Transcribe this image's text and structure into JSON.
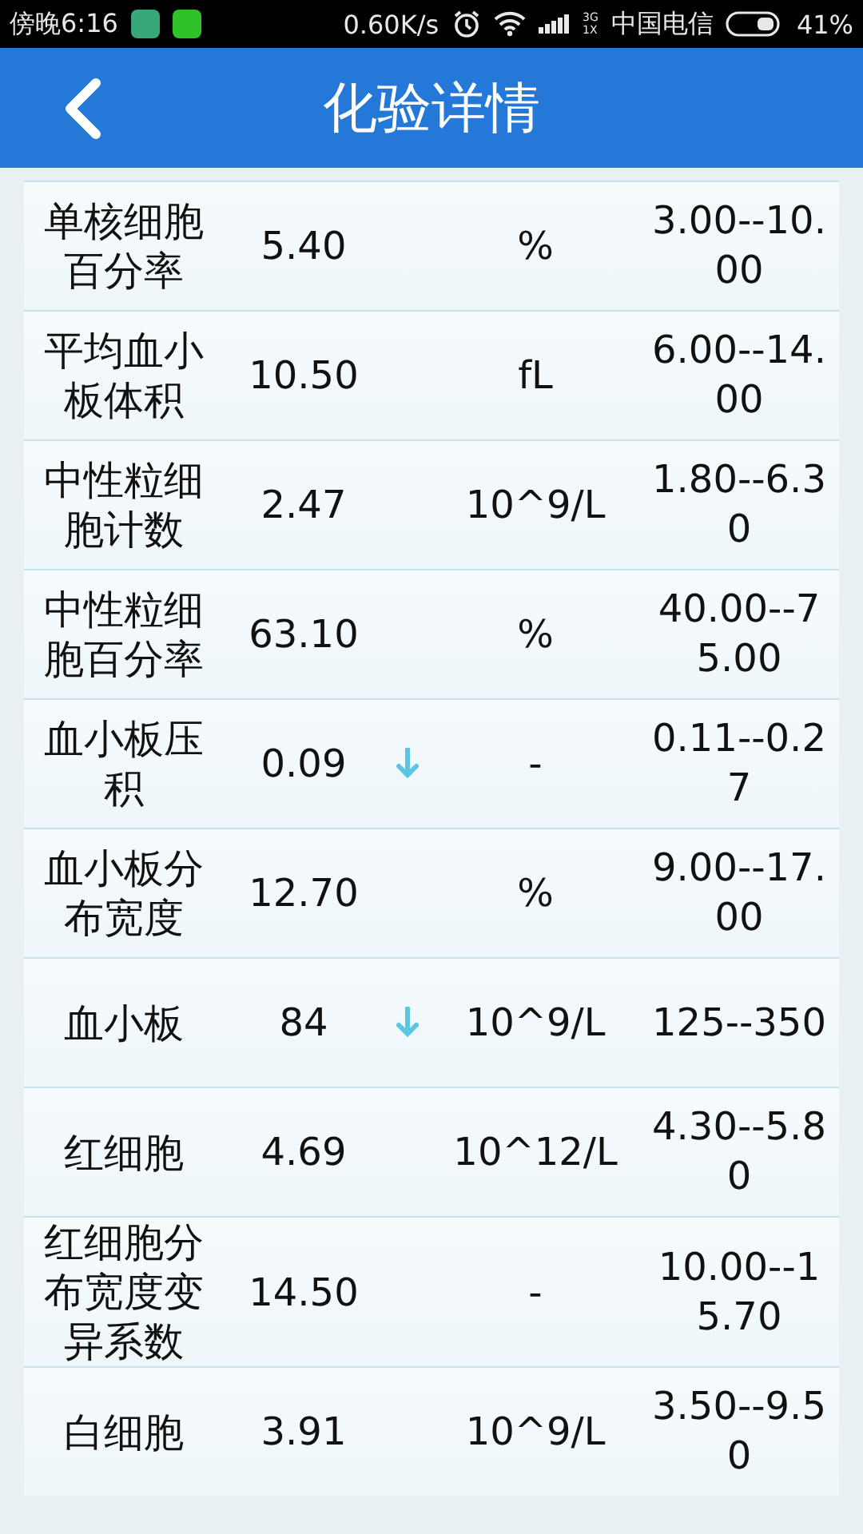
{
  "status_bar": {
    "time": "傍晚6:16",
    "speed": "0.60K/s",
    "network_type_top": "3G",
    "network_type_bottom": "1X",
    "carrier": "中国电信",
    "battery": "41%"
  },
  "header": {
    "title": "化验详情"
  },
  "results": [
    {
      "name": "单核细胞百分率",
      "value": "5.40",
      "low": false,
      "unit": "%",
      "range": "3.00--10.00"
    },
    {
      "name": "平均血小板体积",
      "value": "10.50",
      "low": false,
      "unit": "fL",
      "range": "6.00--14.00"
    },
    {
      "name": "中性粒细胞计数",
      "value": "2.47",
      "low": false,
      "unit": "10^9/L",
      "range": "1.80--6.30"
    },
    {
      "name": "中性粒细胞百分率",
      "value": "63.10",
      "low": false,
      "unit": "%",
      "range": "40.00--75.00"
    },
    {
      "name": "血小板压积",
      "value": "0.09",
      "low": true,
      "unit": "-",
      "range": "0.11--0.27"
    },
    {
      "name": "血小板分布宽度",
      "value": "12.70",
      "low": false,
      "unit": "%",
      "range": "9.00--17.00"
    },
    {
      "name": "血小板",
      "value": "84",
      "low": true,
      "unit": "10^9/L",
      "range": "125--350"
    },
    {
      "name": "红细胞",
      "value": "4.69",
      "low": false,
      "unit": "10^12/L",
      "range": "4.30--5.80"
    },
    {
      "name": "红细胞分布宽度变异系数",
      "value": "14.50",
      "low": false,
      "unit": "-",
      "range": "10.00--15.70"
    },
    {
      "name": "白细胞",
      "value": "3.91",
      "low": false,
      "unit": "10^9/L",
      "range": "3.50--9.50"
    }
  ]
}
